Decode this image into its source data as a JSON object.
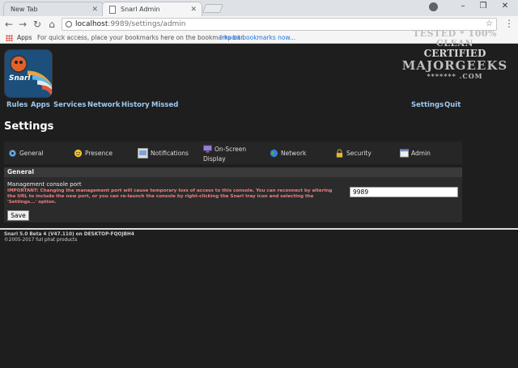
{
  "browser": {
    "tabs": [
      {
        "title": "New Tab",
        "active": false
      },
      {
        "title": "Snarl Admin",
        "active": true
      }
    ],
    "address": {
      "host": "localhost",
      "path": ":9989/settings/admin"
    },
    "bookmarks": {
      "apps_label": "Apps",
      "hint": "For quick access, place your bookmarks here on the bookmarks bar.",
      "import_link": "Import bookmarks now..."
    }
  },
  "app": {
    "logo_text": "Snarl",
    "nav_left": [
      "Rules",
      "Apps",
      "Services",
      "Network",
      "History",
      "Missed"
    ],
    "nav_right": [
      "Settings",
      "Quit"
    ],
    "page_title": "Settings",
    "settings_tabs": [
      {
        "label": "General",
        "icon": "gear-icon"
      },
      {
        "label": "Presence",
        "icon": "smiley-icon"
      },
      {
        "label": "Notifications",
        "icon": "notification-window-icon"
      },
      {
        "label_line1": "On-Screen",
        "label_line2": "Display",
        "icon": "display-icon"
      },
      {
        "label": "Network",
        "icon": "globe-icon"
      },
      {
        "label": "Security",
        "icon": "padlock-icon"
      },
      {
        "label": "Admin",
        "icon": "admin-window-icon"
      }
    ],
    "panel": {
      "header": "General",
      "field_label": "Management console port",
      "warning": "IMPORTANT: Changing the management port will cause temporary loss of access to this console. You can reconnect by altering the URL to include the new port, or you can re-launch the console by right-clicking the Snarl tray icon and selecting the 'Settings...' option.",
      "port_value": "9989",
      "save_label": "Save"
    },
    "footer": {
      "version": "Snarl 5.0 Beta 4 (V47.110) on DESKTOP-FQOJBH4",
      "copyright": "©2005-2017 full phat products"
    }
  },
  "watermark": {
    "line1": "TESTED * 100% CLEAN",
    "line2": "CERTIFIED",
    "line3": "MAJORGEEKS",
    "line4": "******* .COM"
  },
  "colors": {
    "page_bg": "#1e1e1e",
    "nav_link": "#9ec9f0",
    "warning": "#f07f7f"
  }
}
